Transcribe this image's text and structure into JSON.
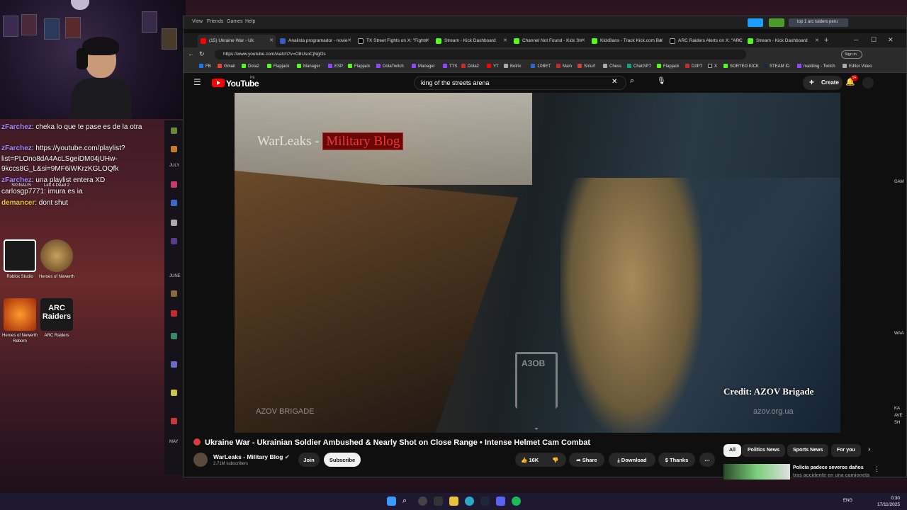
{
  "chat": [
    {
      "user": "zFarchez",
      "msg": ": cheka lo que te pase es de la otra"
    },
    {
      "user": "zFarchez",
      "msg": ": https://youtube.com/playlist?"
    },
    {
      "user": "",
      "msg": "list=PLOno8dA4AcLSgeiDM04jUHw-"
    },
    {
      "user": "",
      "msg": "9kccs8G_L&si=9MF6iWKrzKGLOQfk"
    },
    {
      "user": "zFarchez",
      "msg": ": una playlist entera XD"
    },
    {
      "user": "carlosgp7771",
      "msg": ": imura es ia"
    },
    {
      "user": "demancer",
      "msg": ": dont shut"
    }
  ],
  "desktop_icons": [
    {
      "label": "SIGNALIS"
    },
    {
      "label": "Left 4 Dead 2"
    },
    {
      "label": "Roblox Studio"
    },
    {
      "label": "Heroes of Newerth"
    },
    {
      "label": "Heroes of Newerth Reborn"
    },
    {
      "label": "ARC Raiders"
    }
  ],
  "sidestrip": {
    "labels": [
      "JULY",
      "JUNE",
      "MAY"
    ]
  },
  "titlebar": {
    "menus": [
      "View",
      "Friends",
      "Games",
      "Help"
    ],
    "search_value": "top 1 arc raiders peru"
  },
  "tabs": [
    {
      "label": "(15) Ukraine War - Uk",
      "active": true
    },
    {
      "label": "Analista programador - novie"
    },
    {
      "label": "TX Street Fights on X: \"Fights"
    },
    {
      "label": "Stream - Kick Dashboard"
    },
    {
      "label": "Channel Not Found - Kick Str"
    },
    {
      "label": "KickBans - Track Kick.com Ba"
    },
    {
      "label": "ARC Raiders Alerts on X: \"ARC"
    },
    {
      "label": "Stream - Kick Dashboard"
    }
  ],
  "address": {
    "url": "https://www.youtube.com/watch?v=O8UsoCjNgOs",
    "signin": "Sign in"
  },
  "bookmarks": [
    "FB",
    "Gmail",
    "Dota2",
    "Flapjack",
    "Manager",
    "ESP",
    "Flapjack",
    "DotaTwitch",
    "Manager",
    "TTS",
    "Dota2",
    "YT",
    "Botrix",
    "1XBET",
    "Main",
    "Smurf",
    "Chess",
    "ChatGPT",
    "Flapjack",
    "D2PT",
    "X",
    "SORTEO KICK",
    "STEAM ID",
    "maldiing - Twitch",
    "Editor Video"
  ],
  "youtube": {
    "logo_text": "YouTube",
    "region": "PE",
    "search_value": "king of the streets arena",
    "create_label": "Create",
    "notif_count": "9+"
  },
  "video": {
    "watermark_left": "WarLeaks - ",
    "watermark_right": "Military Blog",
    "credit": "Credit: AZOV Brigade",
    "brigade_text": "AZOV BRIGADE",
    "site_text": "azov.org.ua",
    "logo_text": "A3OB"
  },
  "info": {
    "title": "Ukraine War - Ukrainian Soldier Ambushed & Nearly Shot on Close Range • Intense Helmet Cam Combat",
    "channel": "WarLeaks - Military Blog",
    "subscribers": "2.71M subscribers",
    "join": "Join",
    "subscribe": "Subscribe",
    "likes": "16K",
    "share": "Share",
    "download": "Download",
    "thanks": "Thanks"
  },
  "chips": [
    "All",
    "Politics News",
    "Sports News",
    "For you"
  ],
  "related": {
    "title": "Policía padece severos daños",
    "subtitle": "tras accidente en una camioneta"
  },
  "taskbar": {
    "lang": "ENG",
    "time": "0:30",
    "date": "17/11/2025"
  },
  "right_panel": [
    "GAM",
    "WAA",
    "KA",
    "AVE",
    "SH"
  ]
}
